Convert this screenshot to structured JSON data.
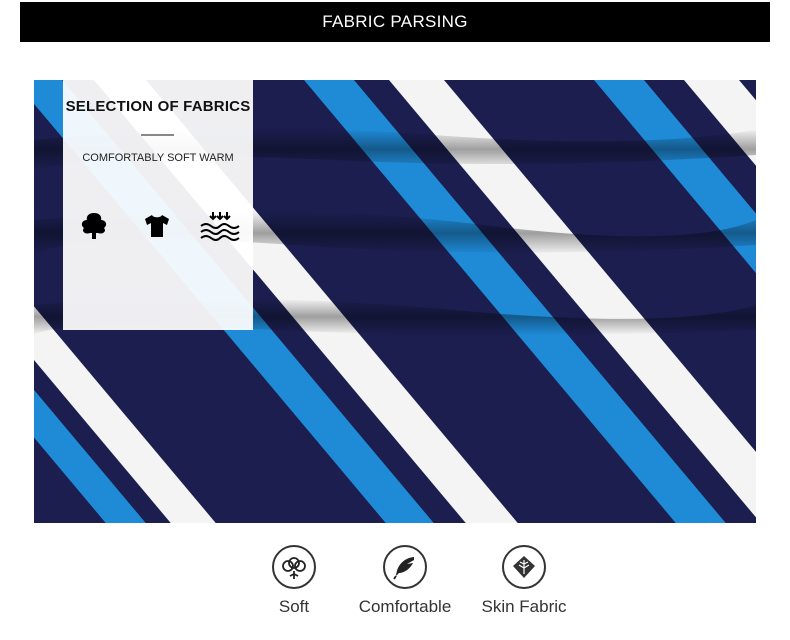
{
  "banner": {
    "title": "FABRIC PARSING"
  },
  "card": {
    "title": "SELECTION OF FABRICS",
    "subtitle": "COMFORTABLY SOFT WARM",
    "icons": [
      "cotton-tree-icon",
      "tshirt-icon",
      "water-absorb-icon"
    ]
  },
  "features": [
    {
      "label": "Soft",
      "icon": "cotton-flower-icon"
    },
    {
      "label": "Comfortable",
      "icon": "feather-icon"
    },
    {
      "label": "Skin Fabric",
      "icon": "modal-leaf-icon"
    }
  ],
  "colors": {
    "navy": "#1a1d4a",
    "blue": "#1f8ad6",
    "white": "#ffffff",
    "banner": "#000000"
  }
}
